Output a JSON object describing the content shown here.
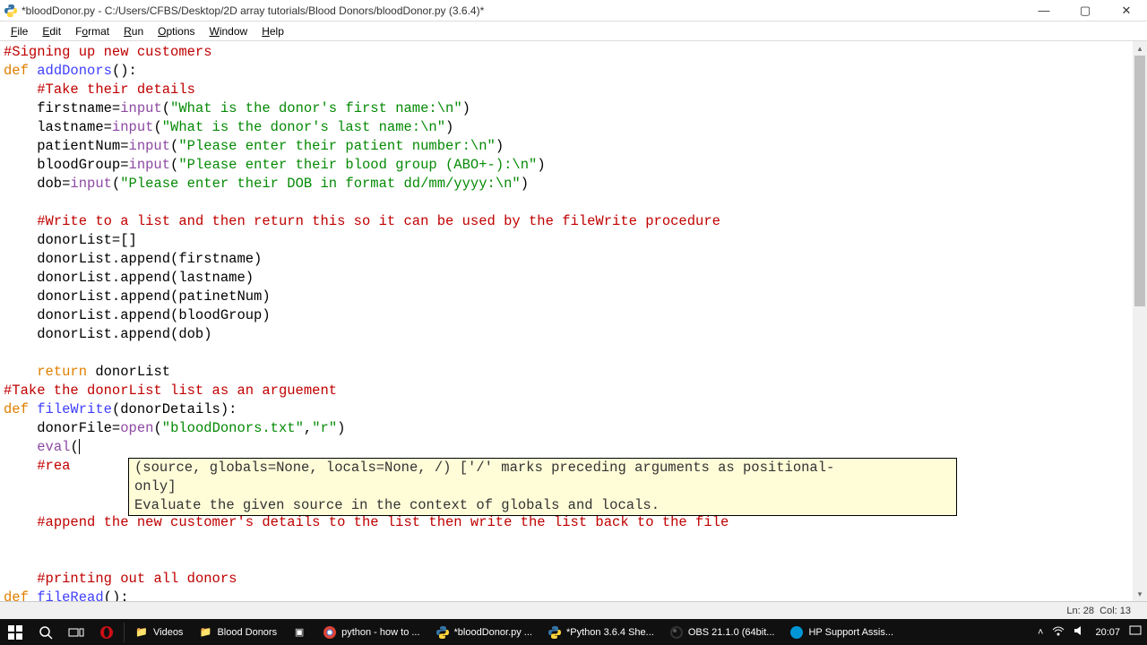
{
  "window": {
    "title": "*bloodDonor.py - C:/Users/CFBS/Desktop/2D array tutorials/Blood Donors/bloodDonor.py (3.6.4)*"
  },
  "menubar": [
    "File",
    "Edit",
    "Format",
    "Run",
    "Options",
    "Window",
    "Help"
  ],
  "code": {
    "c1": "#Signing up new customers",
    "def": "def",
    "addDonors": "addDonors",
    "parenColon": "():",
    "c2": "#Take their details",
    "l_firstname_a": "    firstname=",
    "input": "input",
    "l_firstname_b": "(",
    "s_firstname": "\"What is the donor's first name:\\n\"",
    "l_firstname_c": ")",
    "l_lastname_a": "    lastname=",
    "s_lastname": "\"What is the donor's last name:\\n\"",
    "l_patient_a": "    patientNum=",
    "s_patient": "\"Please enter their patient number:\\n\"",
    "l_blood_a": "    bloodGroup=",
    "s_blood": "\"Please enter their blood group (ABO+-):\\n\"",
    "l_dob_a": "    dob=",
    "s_dob": "\"Please enter their DOB in format dd/mm/yyyy:\\n\"",
    "close_paren": ")",
    "open_paren": "(",
    "c3": "#Write to a list and then return this so it can be used by the fileWrite procedure",
    "l_list": "    donorList=[]",
    "l_app1": "    donorList.append(firstname)",
    "l_app2": "    donorList.append(lastname)",
    "l_app3": "    donorList.append(patinetNum)",
    "l_app4": "    donorList.append(bloodGroup)",
    "l_app5": "    donorList.append(dob)",
    "return": "return",
    "ret_tail": " donorList",
    "c4": "#Take the donorList list as an arguement",
    "fileWrite": "fileWrite",
    "fw_args": "(donorDetails):",
    "l_open_a": "    donorFile=",
    "open": "open",
    "s_bd": "\"bloodDonors.txt\"",
    "comma": ",",
    "s_r": "\"r\"",
    "l_eval": "    ",
    "eval": "eval",
    "l_rea": "    ",
    "c_rea": "#rea",
    "c5": "#append the new customer's details to the list then write the list back to the file",
    "c6": "#printing out all donors",
    "fileRead": "fileRead",
    "fr_args": "():"
  },
  "calltip": {
    "l1": "(source, globals=None, locals=None, /) ['/' marks preceding arguments as positional-",
    "l2": "    only]",
    "l3": "Evaluate the given source in the context of globals and locals."
  },
  "statusbar": {
    "ln": "Ln: 28",
    "col": "Col: 13"
  },
  "taskbar": {
    "items": [
      {
        "icon": "folder",
        "label": "Videos"
      },
      {
        "icon": "folder",
        "label": "Blood Donors"
      },
      {
        "icon": "app",
        "label": ""
      },
      {
        "icon": "chrome",
        "label": "python - how to ..."
      },
      {
        "icon": "py",
        "label": "*bloodDonor.py ..."
      },
      {
        "icon": "py",
        "label": "*Python 3.6.4 She..."
      },
      {
        "icon": "obs",
        "label": "OBS 21.1.0 (64bit..."
      },
      {
        "icon": "hp",
        "label": "HP Support Assis..."
      }
    ],
    "time": "20:07",
    "sysicons": [
      "^",
      "wifi",
      "vol"
    ]
  }
}
